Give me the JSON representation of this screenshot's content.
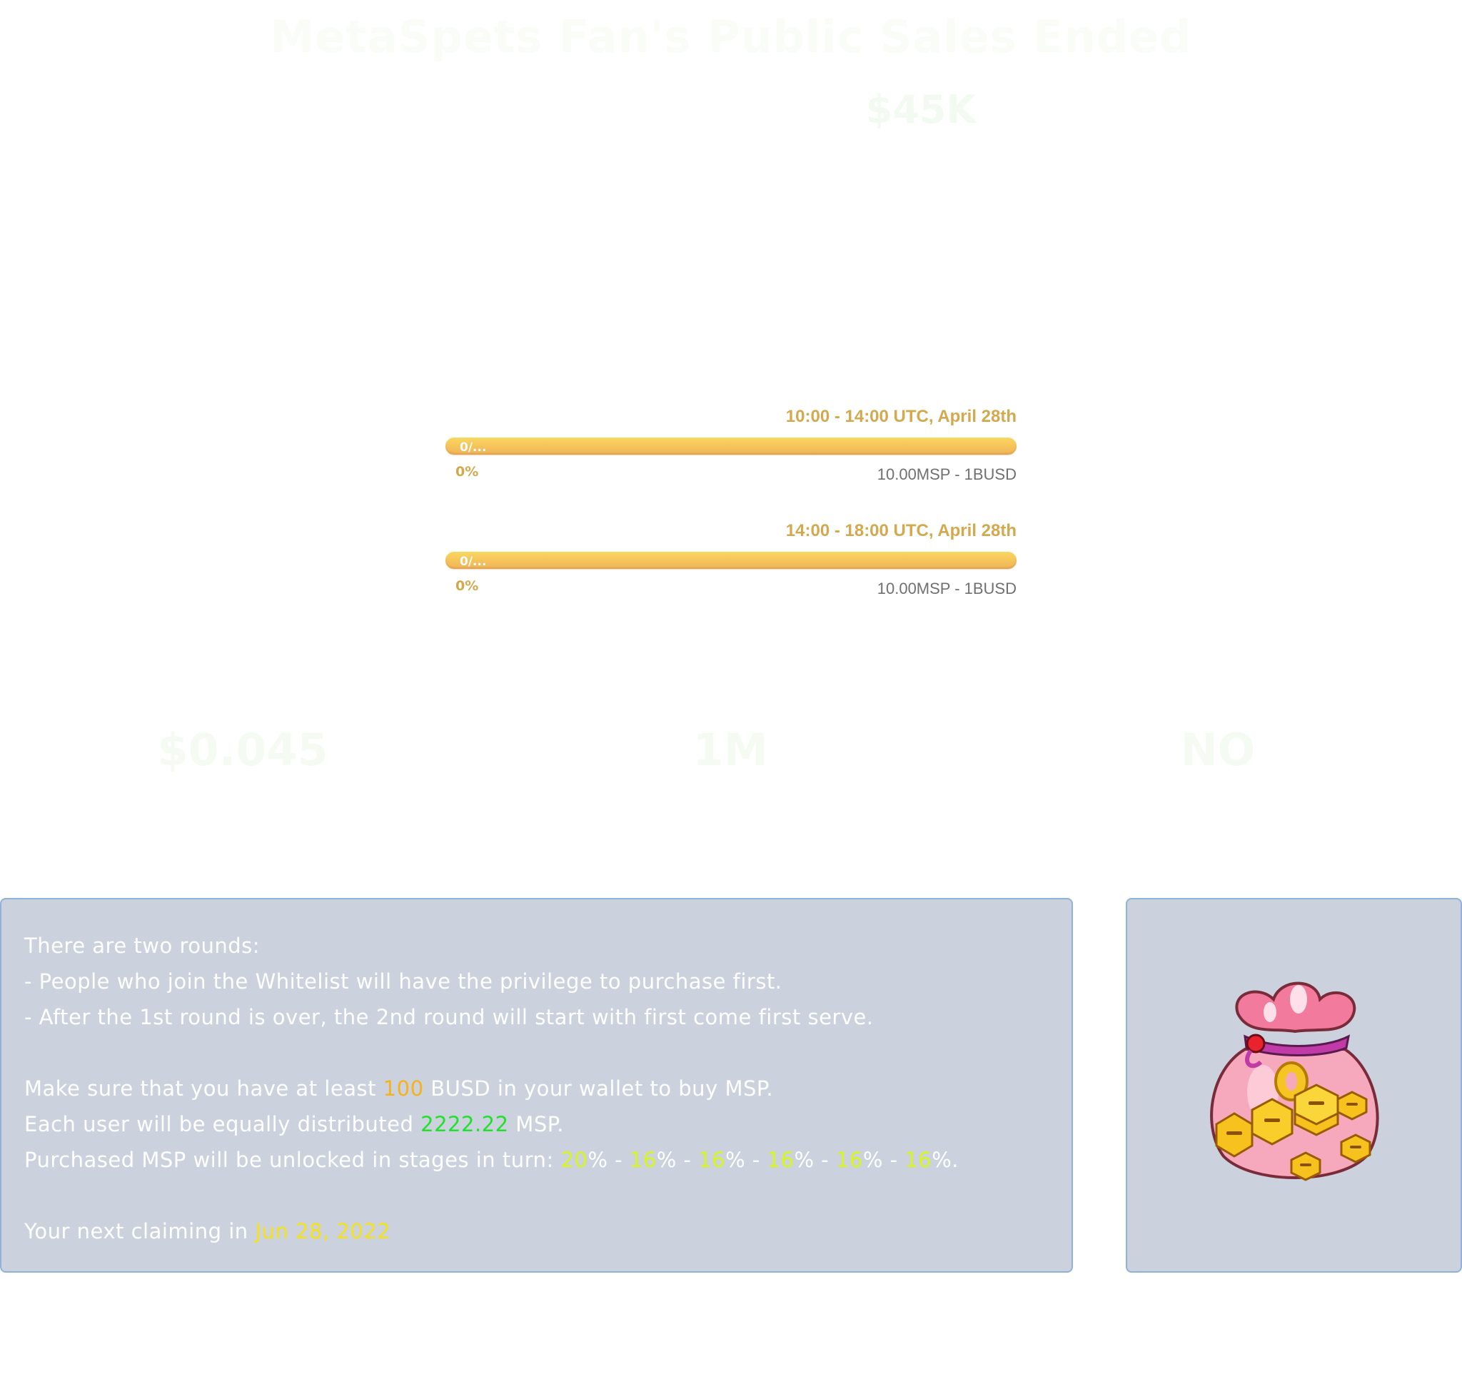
{
  "header": {
    "title": "MetaSpets Fan's Public Sales Ended",
    "raised": "$45K"
  },
  "rounds": [
    {
      "time": "10:00 - 14:00 UTC, April 28th",
      "bar_label": "0/...",
      "progress_percent": 0,
      "percent_text": "0%",
      "rate": "10.00MSP - 1BUSD"
    },
    {
      "time": "14:00 - 18:00 UTC, April 28th",
      "bar_label": "0/...",
      "progress_percent": 0,
      "percent_text": "0%",
      "rate": "10.00MSP - 1BUSD"
    }
  ],
  "stats": {
    "price": "$0.045",
    "supply": "1M",
    "vesting": "NO"
  },
  "info": {
    "line1": "There are two rounds:",
    "line2": "- People who join the Whitelist will have the privilege to purchase first.",
    "line3": "- After the 1st round is over, the 2nd round will start with first come first serve.",
    "min_prefix": "Make sure that you have at least ",
    "min_amount": "100",
    "min_suffix": " BUSD in your wallet to buy MSP.",
    "dist_prefix": "Each user will be equally distributed ",
    "dist_amount": "2222.22",
    "dist_suffix": " MSP.",
    "unlock_prefix": "Purchased MSP will be unlocked in stages in turn: ",
    "unlock_stages": [
      "20",
      "16",
      "16",
      "16",
      "16",
      "16"
    ],
    "pct": "%",
    "sep": " - ",
    "end": ".",
    "claim_prefix": "Your next claiming in ",
    "claim_date": "Jun 28, 2022"
  },
  "colors": {
    "accent_orange": "#f5b21a",
    "accent_green": "#22e02c",
    "accent_lime": "#d7f51f",
    "accent_yellow": "#f3e11b",
    "bar_gold": "#f6c65a",
    "panel_bg": "#cbd2dd"
  },
  "icons": {
    "reward": "coin-bag-icon"
  }
}
